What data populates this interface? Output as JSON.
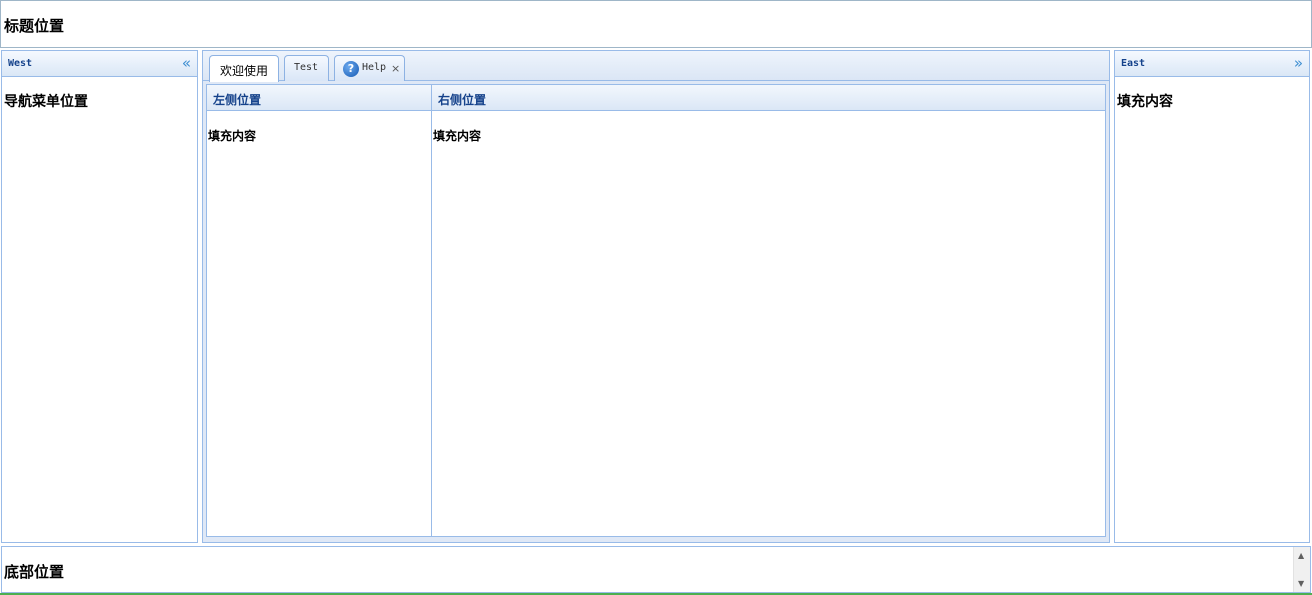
{
  "north": {
    "title": "标题位置"
  },
  "west": {
    "header": "West",
    "collapse_glyph": "«",
    "content": "导航菜单位置"
  },
  "east": {
    "header": "East",
    "collapse_glyph": "»",
    "content": "填充内容"
  },
  "center": {
    "tabs": [
      {
        "label": "欢迎使用",
        "active": true
      },
      {
        "label": "Test",
        "active": false
      },
      {
        "label": "Help",
        "active": false,
        "icon": "help-icon",
        "closable": true,
        "close_glyph": "×"
      }
    ],
    "left_panel": {
      "title": "左侧位置",
      "content": "填充内容"
    },
    "right_panel": {
      "title": "右侧位置",
      "content": "填充内容"
    }
  },
  "south": {
    "title": "底部位置",
    "scroll_up_glyph": "▲",
    "scroll_down_glyph": "▼"
  },
  "help_icon_glyph": "?",
  "colors": {
    "border": "#99bbe8",
    "header_text": "#15428b",
    "collapse_tool": "#3f8fd2",
    "tab_bg": "#dfe8f6"
  }
}
